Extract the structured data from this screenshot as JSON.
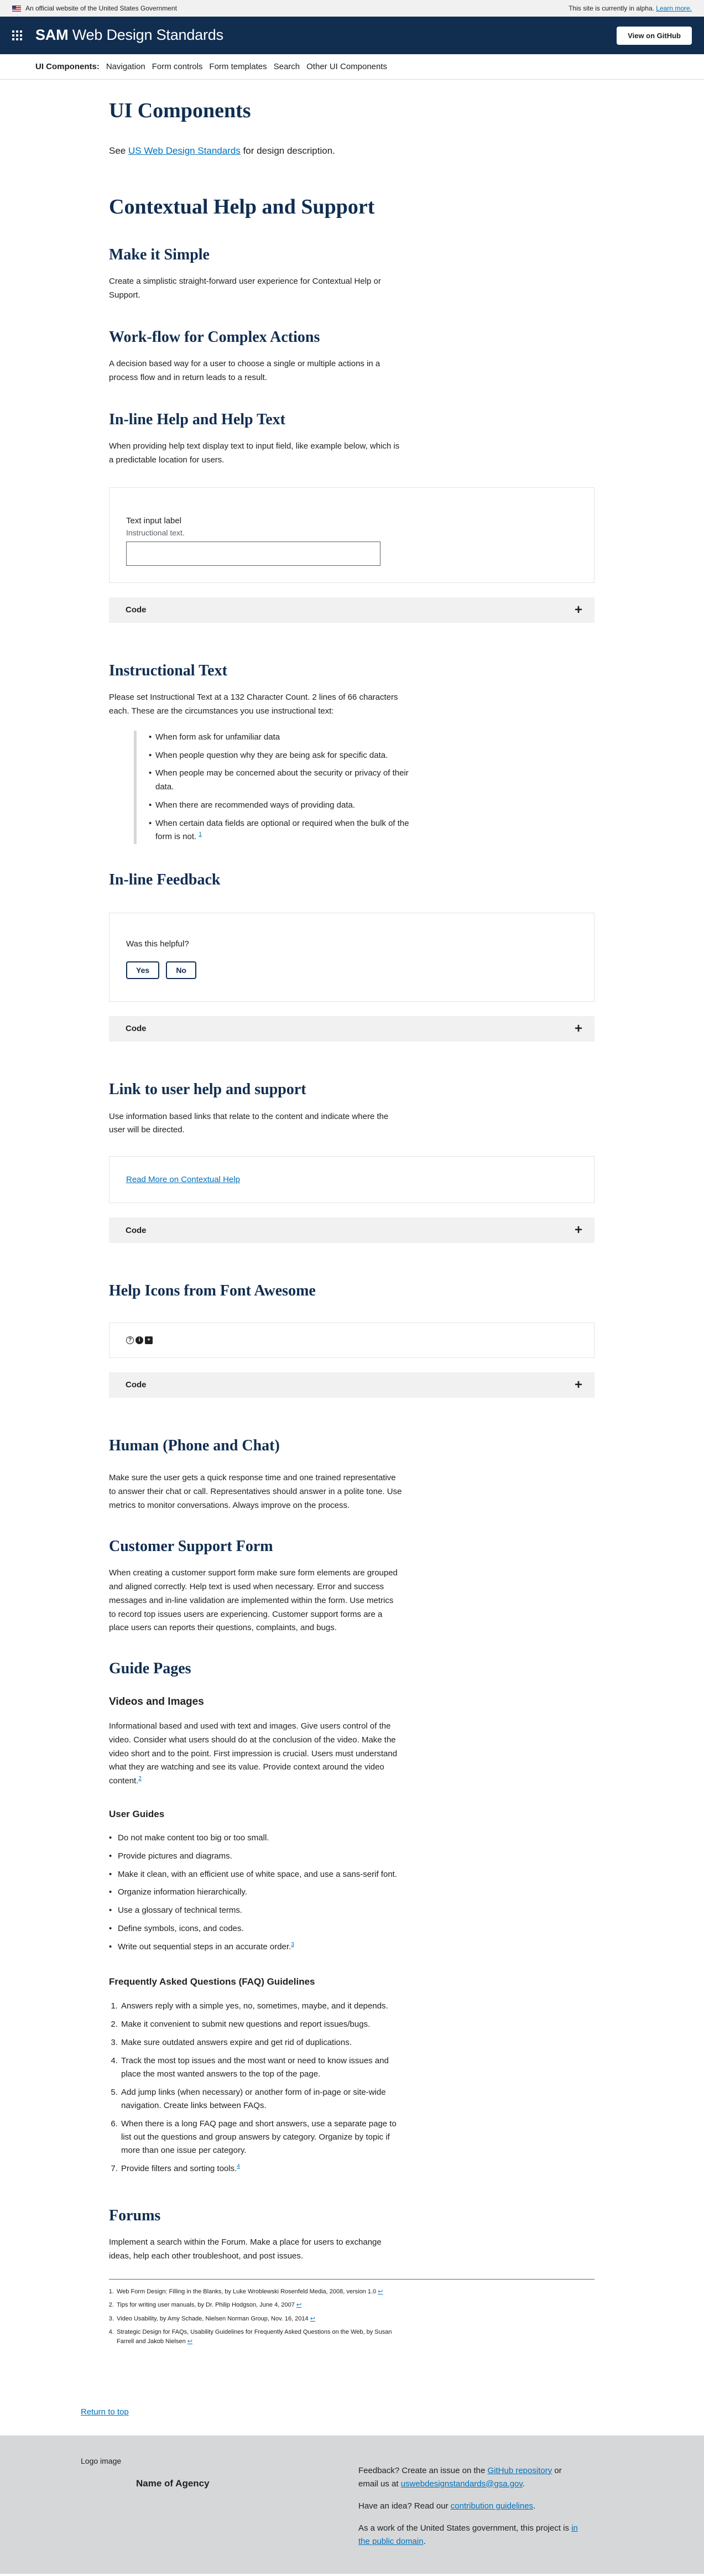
{
  "banner": {
    "official": "An official website of the United States Government",
    "alpha_text": "This site is currently in alpha.",
    "alpha_link": "Learn more."
  },
  "header": {
    "title_bold": "SAM",
    "title_rest": " Web Design Standards",
    "github_label": "View on GitHub",
    "brand_color": "#112e51"
  },
  "subnav": {
    "label": "UI Components:",
    "items": [
      "Navigation",
      "Form controls",
      "Form templates",
      "Search",
      "Other UI Components"
    ]
  },
  "main": {
    "title": "UI Components",
    "intro_prefix": "See ",
    "intro_link": "US Web Design Standards",
    "intro_suffix": " for design description.",
    "heading": "Contextual Help and Support",
    "make_simple": {
      "title": "Make it Simple",
      "text": "Create a simplistic straight-forward user experience for Contextual Help or Support."
    },
    "workflow": {
      "title": "Work-flow for Complex Actions",
      "text": "A decision based way for a user to choose a single or multiple actions in a process flow and in return leads to a result."
    },
    "inline_help": {
      "title": "In-line Help and Help Text",
      "text": "When providing help text display text to input field, like example below, which is a predictable location for users.",
      "input_label": "Text input label",
      "input_hint": "Instructional text.",
      "input_value": ""
    },
    "code_label": "Code",
    "plus_glyph": "+",
    "instructional": {
      "title": "Instructional Text",
      "text": "Please set Instructional Text at a 132 Character Count. 2 lines of 66 characters each. These are the circumstances you use instructional text:",
      "items": [
        "When form ask for unfamiliar data",
        "When people question why they are being ask for specific data.",
        "When people may be concerned about the security or privacy of their data.",
        "When there are recommended ways of providing data.",
        "When certain data fields are optional or required when the bulk of the form is not."
      ],
      "footnote_mark": "1"
    },
    "inline_feedback": {
      "title": "In-line Feedback",
      "question": "Was this helpful?",
      "yes": "Yes",
      "no": "No"
    },
    "link_help": {
      "title": "Link to user help and support",
      "text": "Use information based links that relate to the content and indicate where the user will be directed.",
      "link": "Read More on Contextual Help"
    },
    "help_icons": {
      "title": "Help Icons from Font Awesome",
      "icons": [
        "question-circle-o-icon",
        "info-circle-icon",
        "plus-square-icon"
      ],
      "glyphs": [
        "?",
        "i",
        "+"
      ]
    },
    "human": {
      "title": "Human (Phone and Chat)",
      "text": "Make sure the user gets a quick response time and one trained representative to answer their chat or call. Representatives should answer in a polite tone. Use metrics to monitor conversations. Always improve on the process."
    },
    "support_form": {
      "title": "Customer Support Form",
      "text": "When creating a customer support form make sure form elements are grouped and aligned correctly. Help text is used when necessary. Error and success messages and in-line validation are implemented within the form. Use metrics to record top issues users are experiencing. Customer support forms are a place users can reports their questions, complaints, and bugs."
    },
    "guide": {
      "title": "Guide Pages",
      "videos_title": "Videos and Images",
      "videos_text": "Informational based and used with text and images. Give users control of the video. Consider what users should do at the conclusion of the video. Make the video short and to the point. First impression is crucial. Users must understand what they are watching and see its value. Provide context around the video content.",
      "videos_mark": "2",
      "user_guides_title": "User Guides",
      "user_guides": [
        "Do not make content too big or too small.",
        "Provide pictures and diagrams.",
        "Make it clean, with an efficient use of white space, and use a sans-serif font.",
        "Organize information hierarchically.",
        "Use a glossary of technical terms.",
        "Define symbols, icons, and codes.",
        "Write out sequential steps in an accurate order."
      ],
      "user_guides_mark": "3",
      "faq_title": "Frequently Asked Questions (FAQ) Guidelines",
      "faq": [
        "Answers reply with a simple yes, no, sometimes, maybe, and it depends.",
        "Make it convenient to submit new questions and report issues/bugs.",
        "Make sure outdated answers expire and get rid of duplications.",
        "Track the most top issues and the most want or need to know issues and place the most wanted answers to the top of the page.",
        "Add jump links (when necessary) or another form of in-page or site-wide navigation. Create links between FAQs.",
        "When there is a long FAQ page and short answers, use a separate page to list out the questions and group answers by category. Organize by topic if more than one issue per category.",
        "Provide filters and sorting tools."
      ],
      "faq_mark": "4"
    },
    "forums": {
      "title": "Forums",
      "text": "Implement a search within the Forum. Make a place for users to exchange ideas, help each other troubleshoot, and post issues."
    },
    "footnotes": [
      "Web Form Design: Filling in the Blanks, by Luke Wroblewski Rosenfeld Media, 2008, version 1.0",
      "Tips for writing user manuals, by Dr. Philip Hodgson, June 4, 2007",
      "Video Usability, by Amy Schade, Nielsen Norman Group, Nov. 16, 2014",
      "Strategic Design for FAQs, Usability Guidelines for Frequently Asked Questions on the Web, by Susan Farrell and Jakob Nielsen"
    ],
    "footnote_back": "↩"
  },
  "return_top": "Return to top",
  "footer": {
    "logo": "Logo image",
    "agency": "Name of Agency",
    "feedback_prefix": "Feedback? Create an issue on the ",
    "feedback_link": "GitHub repository",
    "feedback_mid": " or email us at ",
    "feedback_email": "uswebdesignstandards@gsa.gov",
    "feedback_end": ".",
    "idea_prefix": "Have an idea? Read our ",
    "idea_link": "contribution guidelines",
    "idea_end": ".",
    "domain_prefix": "As a work of the United States government, this project is ",
    "domain_link": "in the public domain",
    "domain_end": "."
  }
}
